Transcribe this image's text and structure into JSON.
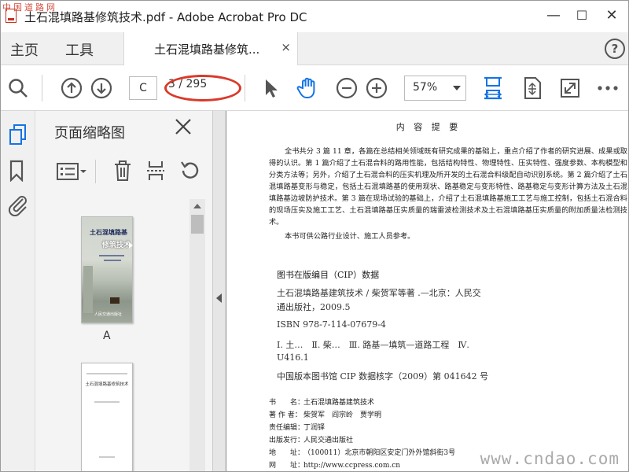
{
  "window": {
    "title": "土石混填路基修筑技术.pdf - Adobe Acrobat Pro DC",
    "watermark": "中国道路网",
    "minimize": "—",
    "maximize": "☐",
    "close": "✕"
  },
  "menu": {
    "home": "主页",
    "tools": "工具",
    "doc_tab": "土石混填路基修筑...",
    "doc_tab_close": "×",
    "help": "?"
  },
  "toolbar": {
    "page_input": "C",
    "page_count": "3 / 295",
    "zoom": "57%"
  },
  "panel": {
    "title": "页面缩略图",
    "thumb1_label": "A",
    "thumb1_cover_title": "土石混填路基",
    "thumb1_cover_title2": "修筑技术",
    "thumb1_cover_publisher": "人民交通出版社",
    "thumb2_title": "土石混填路基修筑技术"
  },
  "document": {
    "heading": "内 容 提 要",
    "summary_p1": "全书共分 3 篇 11 章，各篇在总结相关领域既有研究成果的基础上，重点介绍了作者的研究进展、成果或取得的认识。第 1 篇介绍了土石混合料的路用性能，包括结构特性、物理特性、压实特性、强度参数、本构模型和分类方法等；另外，介绍了土石混合料的压实机理及所开发的土石混合料级配自动识别系统。第 2 篇介绍了土石混填路基变形与稳定，包括土石混填路基的使用现状、路基稳定与变形特性、路基稳定与变形计算方法及土石混填路基边坡防护技术。第 3 篇在现场试验的基础上，介绍了土石混填路基施工工艺与施工控制，包括土石混合料的现场压实及施工工艺、土石混填路基压实质量的瑞雷波检测技术及土石混填路基压实质量的附加质量法检测技术。",
    "summary_p2": "本书可供公路行业设计、施工人员参考。",
    "cip_title": "图书在版编目（CIP）数据",
    "cip_line1": "土石混填路基建筑技术 / 柴贺军等著 .—北京：人民交",
    "cip_line2": "通出版社，2009.5",
    "cip_isbn": "ISBN 978-7-114-07679-4",
    "cip_class1": "Ⅰ. 土…　Ⅱ. 柴…　Ⅲ. 路基—填筑—道路工程　Ⅳ.",
    "cip_class2": "U416.1",
    "cip_lib": "中国版本图书馆 CIP 数据核字（2009）第 041642 号",
    "imprint": [
      {
        "k": "书　　名：",
        "v": "土石混填路基建筑技术"
      },
      {
        "k": "著 作 者：",
        "v": "柴贺军　阎宗岭　贾学明"
      },
      {
        "k": "责任编辑：",
        "v": "丁润铎"
      },
      {
        "k": "出版发行：",
        "v": "人民交通出版社"
      },
      {
        "k": "地　　址：",
        "v": "（100011）北京市朝阳区安定门外外馆斜街3号"
      },
      {
        "k": "网　　址：",
        "v": "http://www.ccpress.com.cn"
      }
    ],
    "site_watermark": "www.cndao.com"
  },
  "colors": {
    "accent_blue": "#1473e6",
    "annotation_red": "#d93a2b"
  }
}
